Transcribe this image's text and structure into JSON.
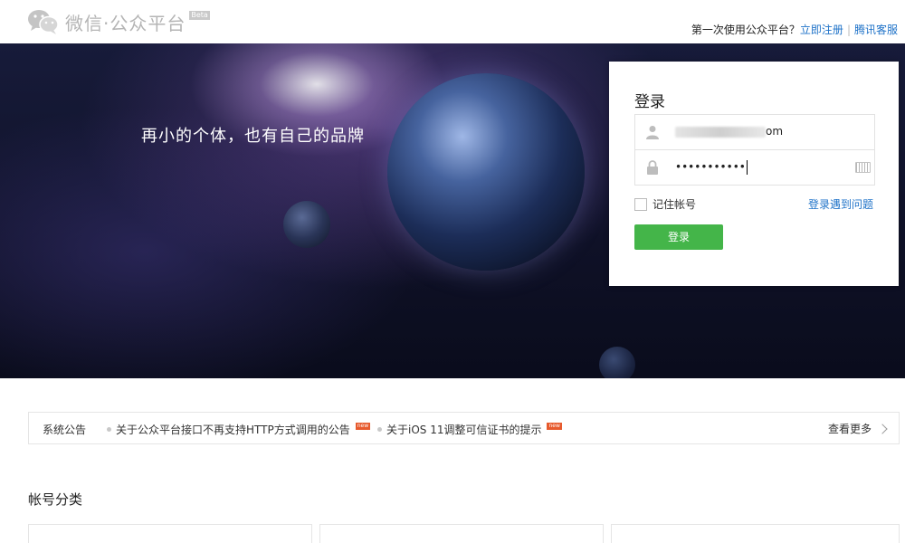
{
  "header": {
    "logo_text": "微信·公众平台",
    "beta": "Beta",
    "question": "第一次使用公众平台？",
    "register": "立即注册",
    "separator": "|",
    "support": "腾讯客服"
  },
  "banner": {
    "slogan": "再小的个体，也有自己的品牌"
  },
  "login": {
    "title": "登录",
    "account_value_suffix": "om",
    "password_value": "•••••••••••",
    "remember": "记住帐号",
    "trouble": "登录遇到问题",
    "button": "登录"
  },
  "notice": {
    "title": "系统公告",
    "items": [
      {
        "text": "关于公众平台接口不再支持HTTP方式调用的公告",
        "badge": "new"
      },
      {
        "text": "关于iOS 11调整可信证书的提示",
        "badge": "new"
      }
    ],
    "more": "查看更多"
  },
  "section": {
    "title": "帐号分类"
  },
  "colors": {
    "link": "#1e72c8",
    "primary_button": "#44b549",
    "badge": "#e75a2d"
  }
}
